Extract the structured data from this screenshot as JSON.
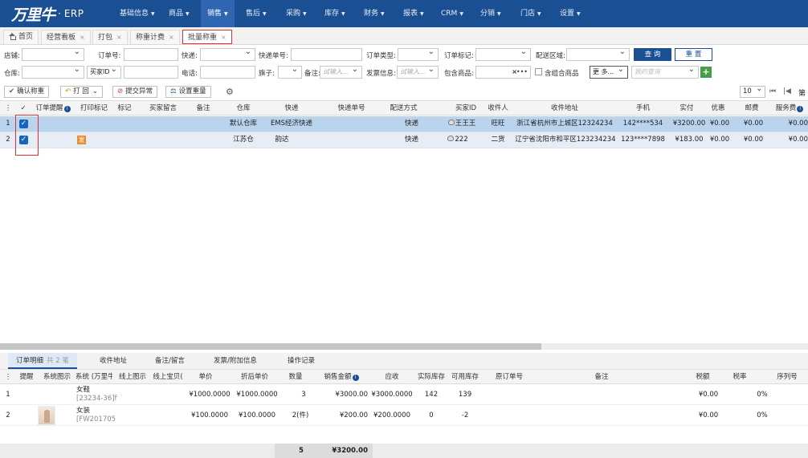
{
  "app": {
    "brand": "万里牛",
    "name": "ERP"
  },
  "nav": [
    {
      "label": "基础信息",
      "caret": "▼"
    },
    {
      "label": "商品",
      "caret": "▼"
    },
    {
      "label": "销售",
      "caret": "▼"
    },
    {
      "label": "售后",
      "caret": "▼"
    },
    {
      "label": "采购",
      "caret": "▼"
    },
    {
      "label": "库存",
      "caret": "▼"
    },
    {
      "label": "财务",
      "caret": "▼"
    },
    {
      "label": "报表",
      "caret": "▼"
    },
    {
      "label": "CRM",
      "caret": "▼"
    },
    {
      "label": "分销",
      "caret": "▼"
    },
    {
      "label": "门店",
      "caret": "▼"
    },
    {
      "label": "设置",
      "caret": "▼"
    }
  ],
  "tabs": [
    {
      "label": "首页"
    },
    {
      "label": "经营看板",
      "close": "×"
    },
    {
      "label": "打包",
      "close": "×"
    },
    {
      "label": "称重计费",
      "close": "×"
    },
    {
      "label": "批量称重",
      "close": "×"
    }
  ],
  "filter": {
    "shop_label": "店铺:",
    "order_no_label": "订单号:",
    "express_label": "快递:",
    "express_no_label": "快递单号:",
    "order_type_label": "订单类型:",
    "order_mark_label": "订单标记:",
    "delivery_area_label": "配送区域:",
    "query_btn": "查 询",
    "reset_btn": "重 置",
    "warehouse_label": "仓库:",
    "buyer_id_select": "买家ID",
    "phone_label": "电话:",
    "flag_label": "旗子:",
    "remark_label": "备注:",
    "remark_placeholder": "试输入...",
    "invoice_label": "发票信息:",
    "invoice_placeholder": "试输入...",
    "contains_goods_label": "包含商品:",
    "contains_goods_clear": "×",
    "contains_goods_more": "•••",
    "combo_goods_label": "含组合商品",
    "more_btn": "更 多...",
    "my_query_placeholder": "我的查询",
    "plus": "+"
  },
  "toolbar": {
    "confirm_weigh": "确认称重",
    "print": "打 回",
    "mark_exception": "提交异常",
    "set_weight": "设置重量",
    "page_size": "10",
    "pager_first": "⏮",
    "pager_prev": "|◀",
    "pager_page": "第"
  },
  "grid": {
    "columns": [
      "⋮",
      "✓",
      "订单提醒",
      "打印标记",
      "标记",
      "买家留言",
      "备注",
      "仓库",
      "快递",
      "快递单号",
      "配送方式",
      "买家ID",
      "收件人",
      "收件地址",
      "手机",
      "实付",
      "优惠",
      "邮费",
      "服务费"
    ],
    "rows": [
      {
        "num": "1",
        "warehouse": "默认仓库",
        "express": "EMS经济快递",
        "express_no": "",
        "delivery": "快递",
        "buyer_id": "王王王",
        "receiver": "旺旺",
        "address": "浙江省杭州市上城区12324234",
        "mobile": "142****534",
        "paid": "¥3200.00",
        "discount": "¥0.00",
        "postage": "¥0.00",
        "service": "¥0.00",
        "print_mark": ""
      },
      {
        "num": "2",
        "warehouse": "江苏仓",
        "express": "韵达",
        "express_no": "",
        "delivery": "快递",
        "buyer_id": "222",
        "receiver": "二货",
        "address": "辽宁省沈阳市和平区123234234",
        "mobile": "123****7898",
        "paid": "¥183.00",
        "discount": "¥0.00",
        "postage": "¥0.00",
        "service": "¥0.00",
        "print_mark": "发"
      }
    ]
  },
  "bottom_tabs": [
    {
      "label": "订单明细",
      "count": "共 2 笔"
    },
    {
      "label": "收件地址"
    },
    {
      "label": "备注/留言"
    },
    {
      "label": "发票/附加信息"
    },
    {
      "label": "操作记录"
    }
  ],
  "detail": {
    "columns": [
      "⋮",
      "提醒",
      "系统图示",
      "系统 (万里牛",
      "线上图示",
      "线上宝贝(",
      "单价",
      "折后单价",
      "数量",
      "销售金额",
      "应收",
      "实际库存",
      "可用库存",
      "原订单号",
      "备注",
      "税额",
      "税率",
      "序列号"
    ],
    "rows": [
      {
        "num": "1",
        "name": "女鞋",
        "code": "[23234-36]f",
        "price": "¥1000.0000",
        "disc_price": "¥1000.0000",
        "qty": "3",
        "amount": "¥3000.00",
        "receivable": "¥3000.0000",
        "actual_stock": "142",
        "avail_stock": "139",
        "tax": "¥0.00",
        "tax_rate": "0%"
      },
      {
        "num": "2",
        "name": "女装",
        "code": "[FW201705",
        "price": "¥100.0000",
        "disc_price": "¥100.0000",
        "qty": "2(件)",
        "amount": "¥200.00",
        "receivable": "¥200.0000",
        "actual_stock": "0",
        "avail_stock": "-2",
        "tax": "¥0.00",
        "tax_rate": "0%"
      }
    ],
    "footer": {
      "qty_total": "5",
      "amount_total": "¥3200.00"
    }
  },
  "colors": {
    "nav_bg": "#1a4f93",
    "selected_row": "#b9d4ec",
    "highlight_box": "#e03030",
    "plus_btn": "#43a047"
  }
}
